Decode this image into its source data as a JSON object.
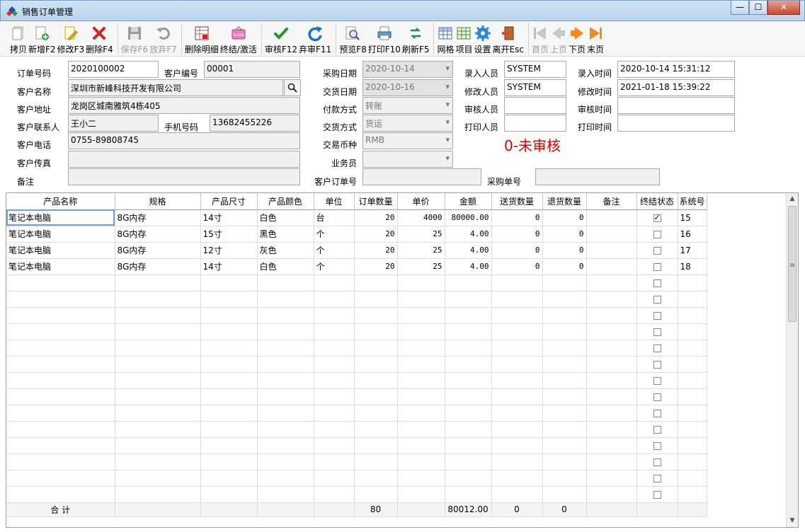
{
  "window": {
    "title": "销售订单管理",
    "close_label": "✕",
    "min_label": "—",
    "max_label": "☐"
  },
  "toolbar": [
    {
      "label": "拷贝",
      "icon": "copy-icon",
      "enabled": true
    },
    {
      "label": "新增F2",
      "icon": "add-document-icon",
      "enabled": true
    },
    {
      "label": "修改F3",
      "icon": "edit-pencil-icon",
      "enabled": true
    },
    {
      "label": "删除F4",
      "icon": "delete-x-icon",
      "enabled": true
    },
    {
      "label": "保存F6",
      "icon": "save-floppy-icon",
      "enabled": false
    },
    {
      "label": "放弃F7",
      "icon": "undo-icon",
      "enabled": false
    },
    {
      "label": "删除明细",
      "icon": "delete-detail-icon",
      "enabled": true
    },
    {
      "label": "终结/激活",
      "icon": "close-sign-icon",
      "enabled": true
    },
    {
      "label": "审核F12",
      "icon": "checkmark-icon",
      "enabled": true
    },
    {
      "label": "弃审F11",
      "icon": "refresh-arrow-icon",
      "enabled": true
    },
    {
      "label": "预览F8",
      "icon": "preview-magnifier-icon",
      "enabled": true
    },
    {
      "label": "打印F10",
      "icon": "printer-icon",
      "enabled": true
    },
    {
      "label": "刷新F5",
      "icon": "refresh-icon",
      "enabled": true
    },
    {
      "label": "网格",
      "icon": "grid-icon",
      "enabled": true
    },
    {
      "label": "项目",
      "icon": "project-icon",
      "enabled": true
    },
    {
      "label": "设置",
      "icon": "gear-icon",
      "enabled": true
    },
    {
      "label": "离开Esc",
      "icon": "exit-door-icon",
      "enabled": true
    },
    {
      "label": "首页",
      "icon": "first-page-icon",
      "enabled": false
    },
    {
      "label": "上页",
      "icon": "prev-page-icon",
      "enabled": false
    },
    {
      "label": "下页",
      "icon": "next-page-icon",
      "enabled": true
    },
    {
      "label": "末页",
      "icon": "last-page-icon",
      "enabled": true
    }
  ],
  "form": {
    "order_no_label": "订单号码",
    "order_no": "2020100002",
    "customer_code_label": "客户编号",
    "customer_code": "00001",
    "customer_name_label": "客户名称",
    "customer_name": "深圳市新峰科技开发有限公司",
    "address_label": "客户地址",
    "address": "龙岗区城南雅筑4栋405",
    "contact_label": "客户联系人",
    "contact": "王小二",
    "mobile_label": "手机号码",
    "mobile": "13682455226",
    "phone_label": "客户电话",
    "phone": "0755-89808745",
    "fax_label": "客户传真",
    "fax": "",
    "remark_label": "备注",
    "remark": "",
    "purchase_date_label": "采购日期",
    "purchase_date": "2020-10-14",
    "delivery_date_label": "交货日期",
    "delivery_date": "2020-10-16",
    "payment_label": "付款方式",
    "payment": "转账",
    "delivery_method_label": "交货方式",
    "delivery_method": "货运",
    "currency_label": "交易币种",
    "currency": "RMB",
    "salesman_label": "业务员",
    "salesman": "",
    "customer_order_no_label": "客户订单号",
    "customer_order_no": "",
    "purchase_no_label": "采购单号",
    "purchase_no": "",
    "entered_by_label": "录入人员",
    "entered_by": "SYSTEM",
    "modified_by_label": "修改人员",
    "modified_by": "SYSTEM",
    "audited_by_label": "审核人员",
    "audited_by": "",
    "printed_by_label": "打印人员",
    "printed_by": "",
    "entered_time_label": "录入时间",
    "entered_time": "2020-10-14 15:31:12",
    "modified_time_label": "修改时间",
    "modified_time": "2021-01-18 15:39:22",
    "audited_time_label": "审核时间",
    "audited_time": "",
    "printed_time_label": "打印时间",
    "printed_time": "",
    "status": "0-未审核"
  },
  "grid": {
    "columns": [
      "产品名称",
      "规格",
      "产品尺寸",
      "产品颜色",
      "单位",
      "订单数量",
      "单价",
      "金额",
      "送货数量",
      "退货数量",
      "备注",
      "终结状态",
      "系统号"
    ],
    "rows": [
      {
        "name": "笔记本电脑",
        "spec": "8G内存",
        "size": "14寸",
        "color": "白色",
        "unit": "台",
        "qty": "20",
        "price": "4000",
        "amount": "80000.00",
        "delivered": "0",
        "returned": "0",
        "remark": "",
        "closed": true,
        "sysno": "15"
      },
      {
        "name": "笔记本电脑",
        "spec": "8G内存",
        "size": "15寸",
        "color": "黑色",
        "unit": "个",
        "qty": "20",
        "price": "25",
        "amount": "4.00",
        "delivered": "0",
        "returned": "0",
        "remark": "",
        "closed": false,
        "sysno": "16"
      },
      {
        "name": "笔记本电脑",
        "spec": "8G内存",
        "size": "12寸",
        "color": "灰色",
        "unit": "个",
        "qty": "20",
        "price": "25",
        "amount": "4.00",
        "delivered": "0",
        "returned": "0",
        "remark": "",
        "closed": false,
        "sysno": "17"
      },
      {
        "name": "笔记本电脑",
        "spec": "8G内存",
        "size": "14寸",
        "color": "白色",
        "unit": "个",
        "qty": "20",
        "price": "25",
        "amount": "4.00",
        "delivered": "0",
        "returned": "0",
        "remark": "",
        "closed": false,
        "sysno": "18"
      }
    ],
    "empty_rows": 14,
    "totals": {
      "label": "合 计",
      "qty": "80",
      "amount": "80012.00",
      "delivered": "0",
      "returned": "0"
    }
  },
  "colors": {
    "status_red": "#e00000",
    "accent_blue": "#2d6fc2"
  }
}
